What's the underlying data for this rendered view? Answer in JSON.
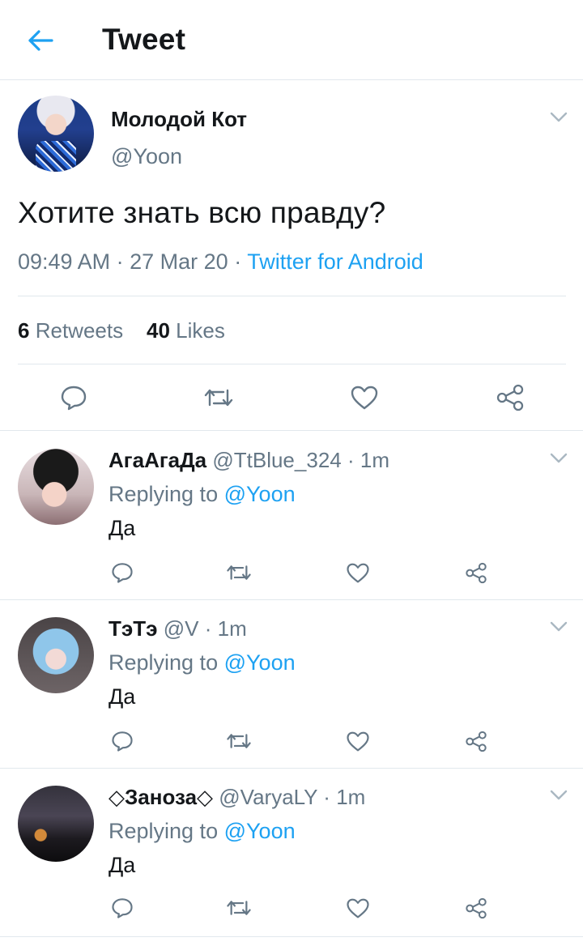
{
  "header": {
    "title": "Tweet"
  },
  "tweet": {
    "author_name": "Молодой Кот",
    "author_handle": "@Yoon",
    "text": "Хотите знать всю правду?",
    "time": "09:49 AM",
    "date": "27 Mar 20",
    "source": "Twitter for Android",
    "retweets_count": "6",
    "retweets_label": "Retweets",
    "likes_count": "40",
    "likes_label": "Likes"
  },
  "replies": [
    {
      "name": "АгаАгаДа",
      "handle": "@TtBlue_324",
      "time": "1m",
      "replying_prefix": "Replying to",
      "replying_to": "@Yoon",
      "text": "Да"
    },
    {
      "name": "ТэТэ",
      "handle": "@V",
      "time": "1m",
      "replying_prefix": "Replying to",
      "replying_to": "@Yoon",
      "text": "Да"
    },
    {
      "name": "◇Заноза◇",
      "handle": "@VaryaLY",
      "time": "1m",
      "replying_prefix": "Replying to",
      "replying_to": "@Yoon",
      "text": "Да"
    }
  ],
  "separator": "·",
  "icons": {
    "back": "arrow-left-icon",
    "menu": "chevron-down-icon",
    "reply": "reply-icon",
    "retweet": "retweet-icon",
    "like": "heart-icon",
    "share": "share-icon"
  },
  "colors": {
    "accent": "#1da1f2",
    "secondary_text": "#657786",
    "divider": "#e1e8ed",
    "icon": "#657786"
  }
}
